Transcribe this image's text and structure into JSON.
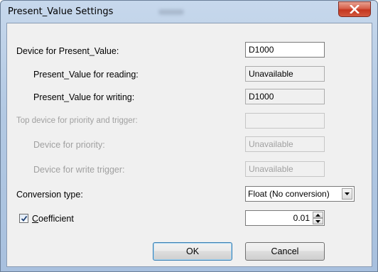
{
  "window": {
    "title": "Present_Value Settings",
    "close_label": "x"
  },
  "form": {
    "device_pv": {
      "label": "Device for Present_Value:",
      "value": "D1000"
    },
    "pv_reading": {
      "label": "Present_Value for reading:",
      "value": "Unavailable"
    },
    "pv_writing": {
      "label": "Present_Value for writing:",
      "value": "D1000"
    },
    "top_device": {
      "label": "Top device for priority and trigger:",
      "value": ""
    },
    "device_priority": {
      "label": "Device for priority:",
      "value": "Unavailable"
    },
    "device_write_trigger": {
      "label": "Device for write trigger:",
      "value": "Unavailable"
    },
    "conversion_type": {
      "label": "Conversion type:",
      "selected": "Float (No conversion)"
    },
    "coefficient": {
      "label_first": "C",
      "label_rest": "oefficient",
      "checked": true,
      "value": "0.01"
    }
  },
  "buttons": {
    "ok": "OK",
    "cancel": "Cancel"
  },
  "colors": {
    "frame": "#b3c9e3",
    "close": "#c5361f",
    "disabled_text": "#a0a0a0"
  }
}
